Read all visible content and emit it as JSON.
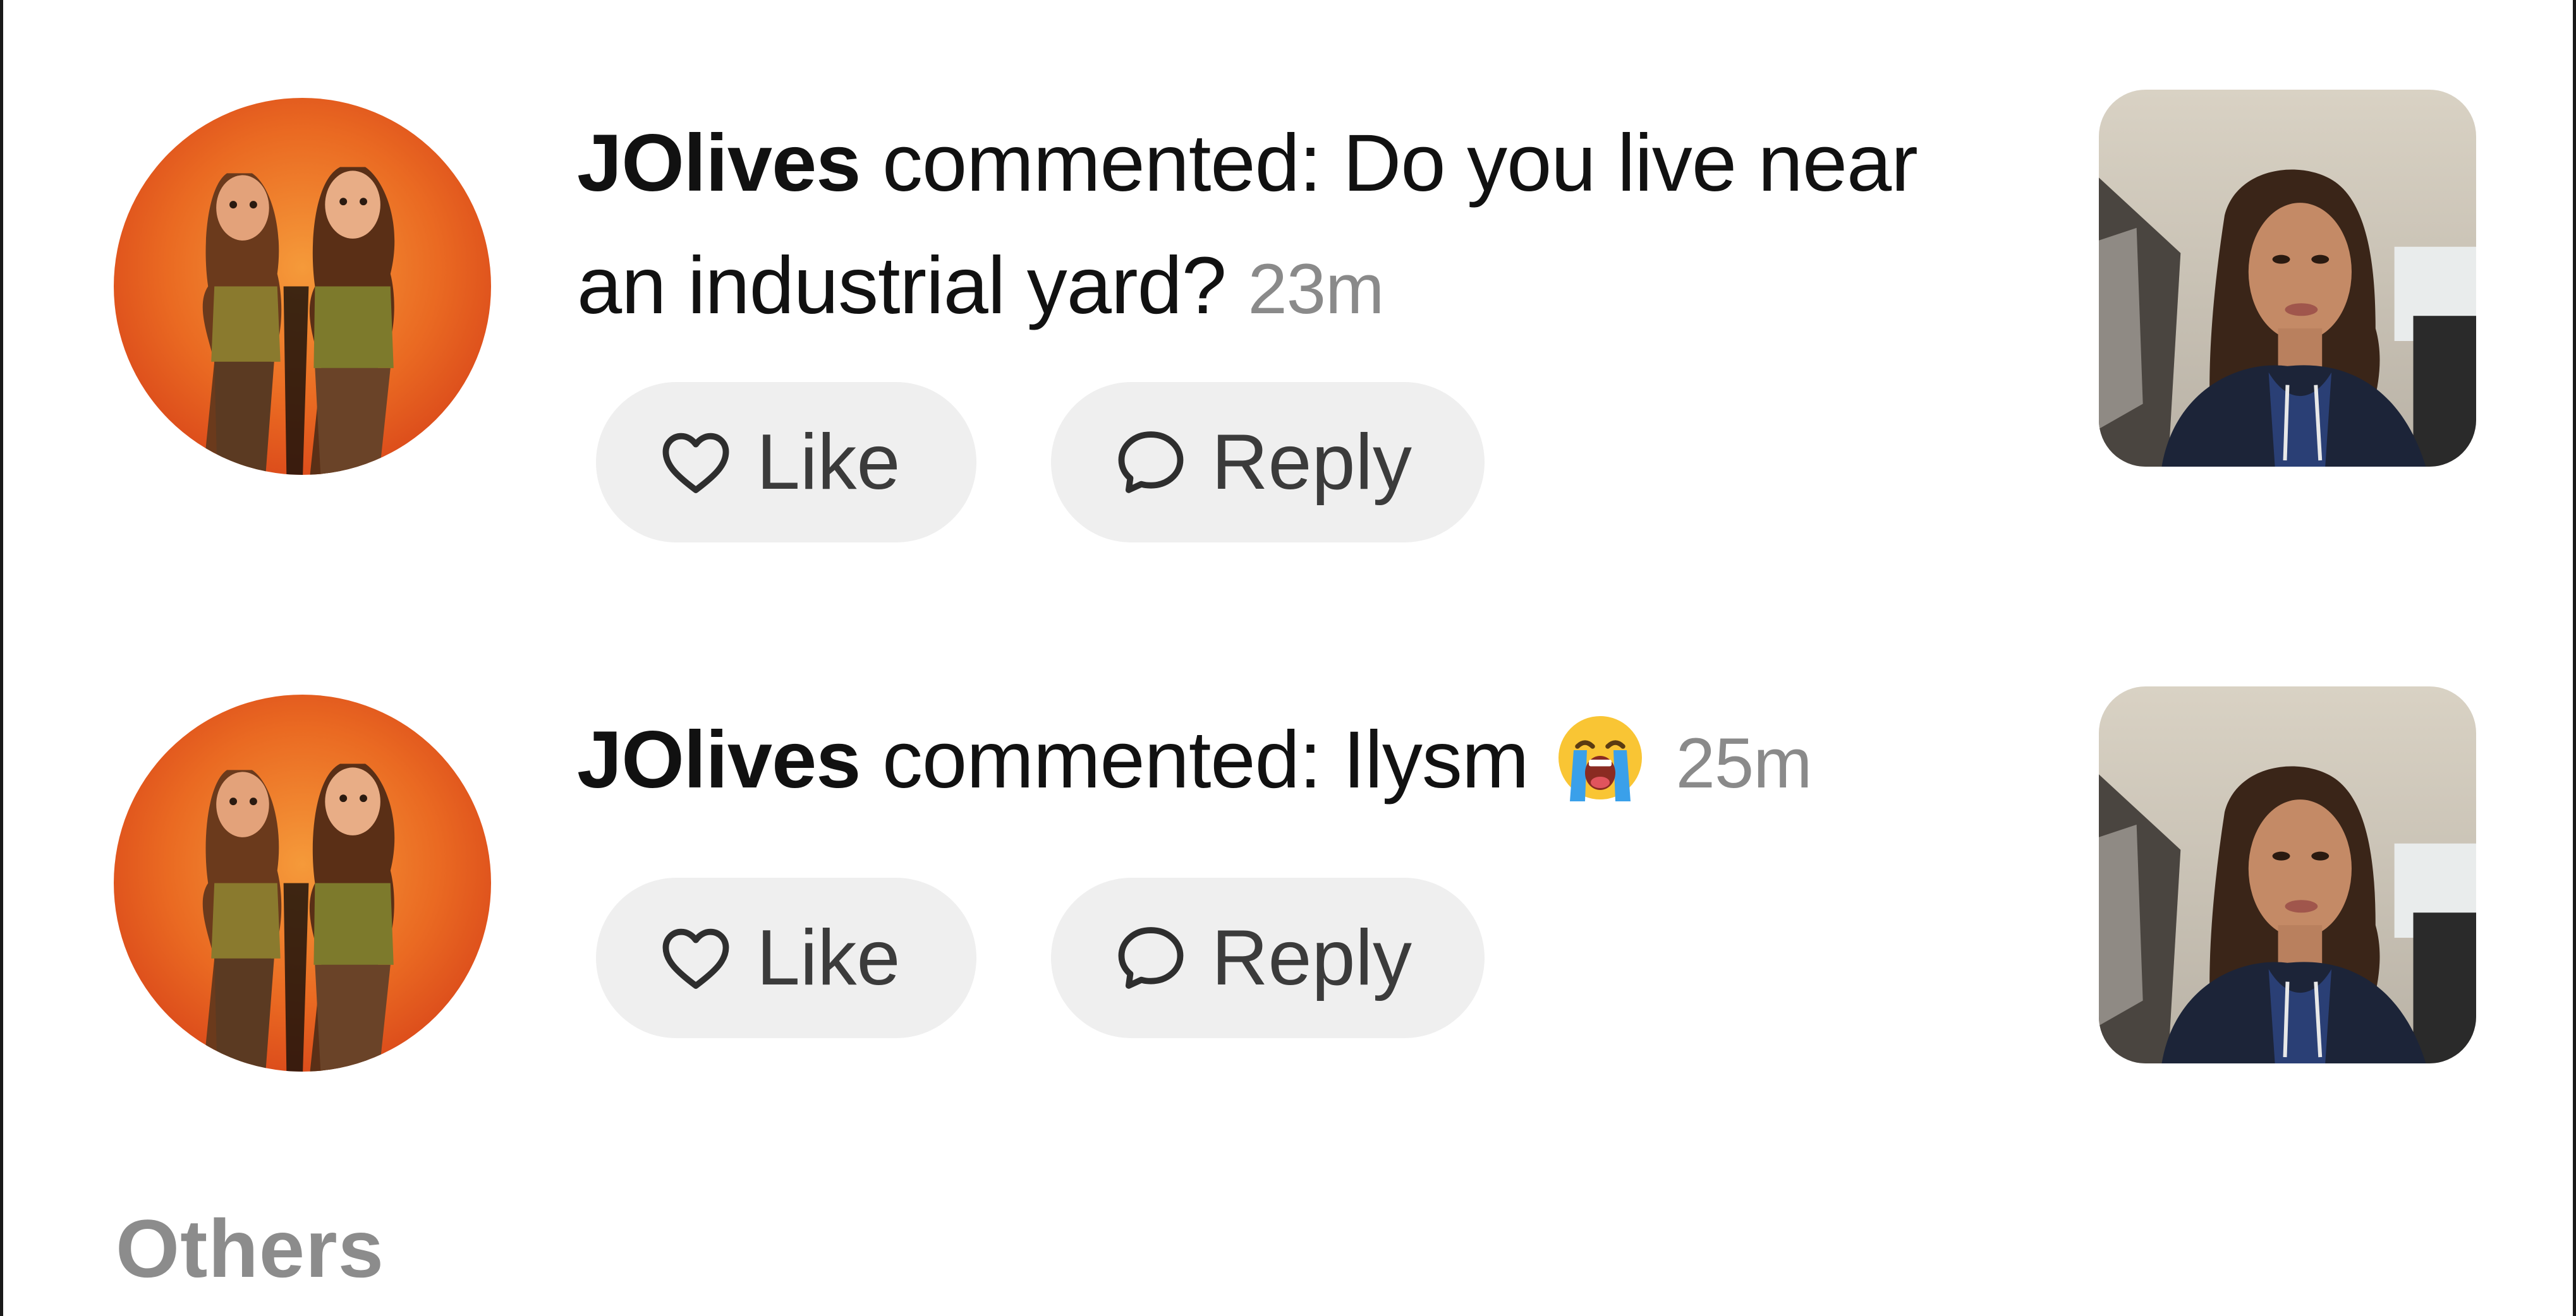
{
  "notifications": [
    {
      "username": "JOlives",
      "action_text": " commented: ",
      "comment": "Do you live near an industrial yard?",
      "emoji": "",
      "time": "23m",
      "like_label": "Like",
      "reply_label": "Reply",
      "avatar_icon": "avatar-cartoon-two-women",
      "thumbnail_icon": "video-thumbnail-woman-in-car"
    },
    {
      "username": "JOlives",
      "action_text": " commented: ",
      "comment": "Ilysm",
      "emoji": "loudly-crying-face-emoji",
      "time": "25m",
      "like_label": "Like",
      "reply_label": "Reply",
      "avatar_icon": "avatar-cartoon-two-women",
      "thumbnail_icon": "video-thumbnail-woman-in-car"
    }
  ],
  "section": {
    "title": "Others"
  },
  "colors": {
    "pill_background": "#efefef",
    "timestamp": "#8a8a8a",
    "section_title": "#8c8c8c",
    "avatar_orange": "#e8541e"
  }
}
